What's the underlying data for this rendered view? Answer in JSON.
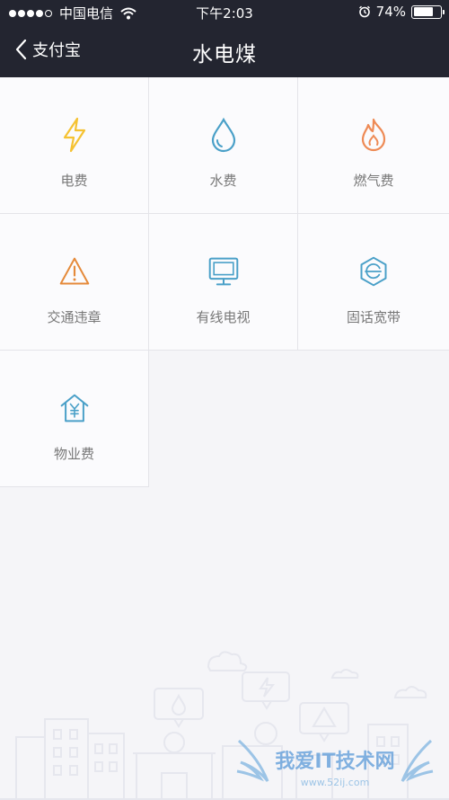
{
  "status": {
    "carrier": "中国电信",
    "time": "下午2:03",
    "battery": "74%",
    "battery_level": 0.74
  },
  "nav": {
    "back_label": "支付宝",
    "title": "水电煤"
  },
  "services": [
    {
      "label": "电费",
      "icon": "lightning-icon",
      "color": "#f5c232"
    },
    {
      "label": "水费",
      "icon": "water-drop-icon",
      "color": "#4aa0c8"
    },
    {
      "label": "燃气费",
      "icon": "flame-icon",
      "color": "#ee8a55"
    },
    {
      "label": "交通违章",
      "icon": "warning-icon",
      "color": "#e58a3a"
    },
    {
      "label": "有线电视",
      "icon": "tv-icon",
      "color": "#4aa0c8"
    },
    {
      "label": "固话宽带",
      "icon": "broadband-icon",
      "color": "#4aa0c8"
    },
    {
      "label": "物业费",
      "icon": "house-yuan-icon",
      "color": "#4aa0c8"
    }
  ],
  "watermark": {
    "title": "我爱IT技术网",
    "url": "www.52ij.com"
  }
}
